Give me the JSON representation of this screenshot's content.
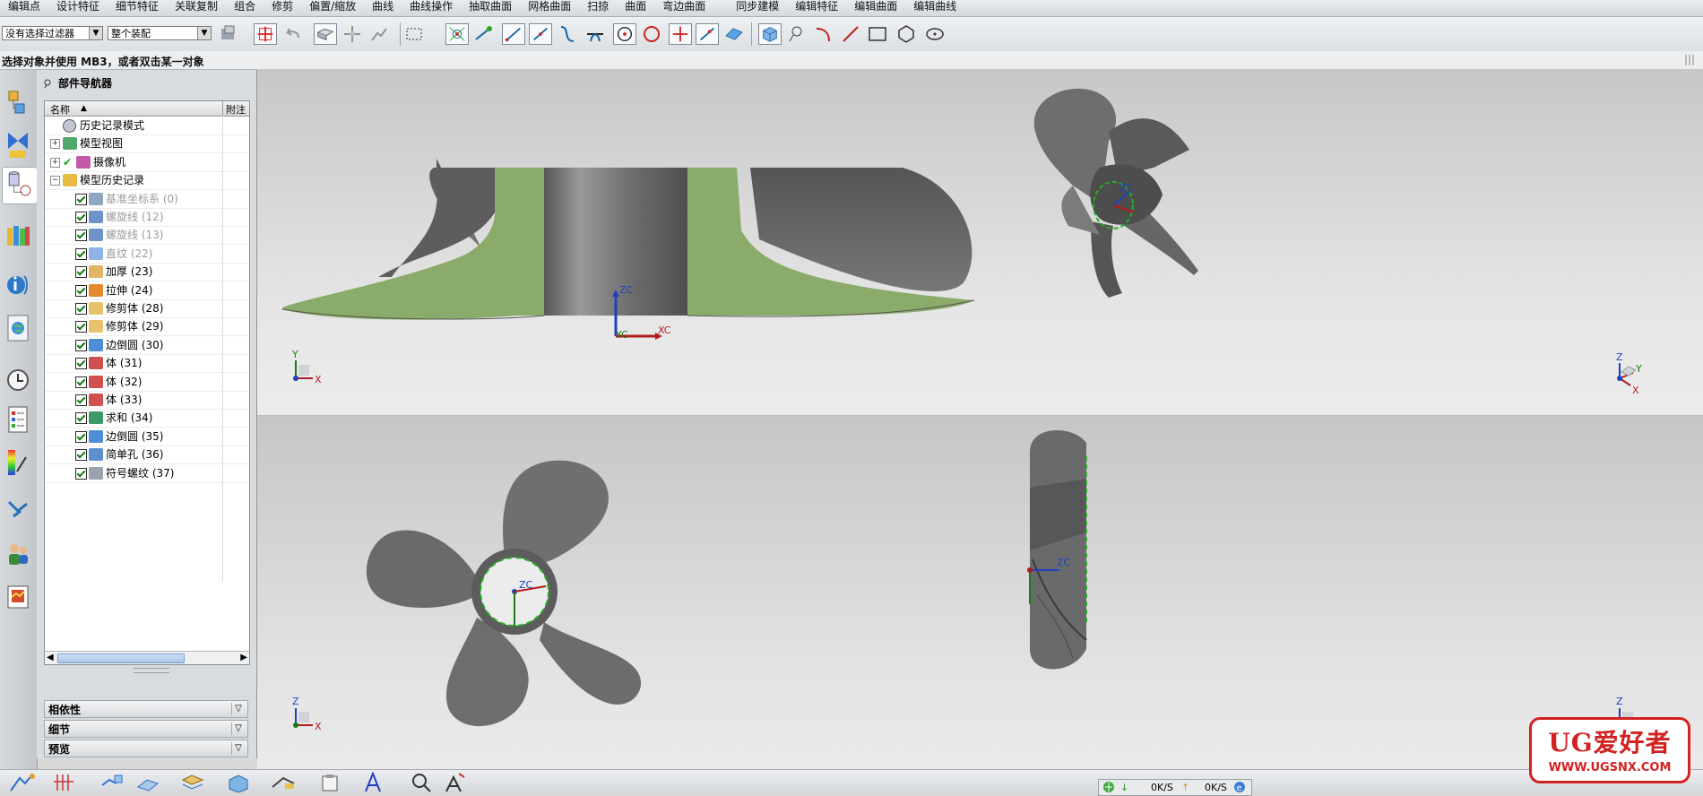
{
  "menubar": {
    "items": [
      "编辑点",
      "设计特征",
      "细节特征",
      "关联复制",
      "组合",
      "修剪",
      "偏置/缩放",
      "曲线",
      "曲线操作",
      "抽取曲面",
      "网格曲面",
      "扫掠",
      "曲面",
      "弯边曲面",
      "同步建模",
      "编辑特征",
      "编辑曲面",
      "编辑曲线"
    ]
  },
  "toolbar": {
    "filter_combo": "没有选择过滤器",
    "scope_combo": "整个装配"
  },
  "prompt": {
    "text": "选择对象并使用 MB3，或者双击某一对象"
  },
  "navigator": {
    "title": "部件导航器",
    "col_name": "名称",
    "col_attach": "附注",
    "nodes": [
      {
        "label": "历史记录模式",
        "kind": "clock",
        "level": 0,
        "expander": "",
        "checked": false,
        "dim": false
      },
      {
        "label": "模型视图",
        "kind": "view",
        "level": 0,
        "expander": "+",
        "checked": false,
        "dim": false
      },
      {
        "label": "摄像机",
        "kind": "camera",
        "level": 0,
        "expander": "+",
        "checked": true,
        "dim": false
      },
      {
        "label": "模型历史记录",
        "kind": "folder",
        "level": 0,
        "expander": "−",
        "checked": false,
        "dim": false
      },
      {
        "label": "基准坐标系 (0)",
        "kind": "csys",
        "level": 1,
        "checked": true,
        "dim": true
      },
      {
        "label": "螺旋线 (12)",
        "kind": "helix",
        "level": 1,
        "checked": true,
        "dim": true
      },
      {
        "label": "螺旋线 (13)",
        "kind": "helix",
        "level": 1,
        "checked": true,
        "dim": true
      },
      {
        "label": "直纹 (22)",
        "kind": "ruled",
        "level": 1,
        "checked": true,
        "dim": true
      },
      {
        "label": "加厚 (23)",
        "kind": "thicken",
        "level": 1,
        "checked": true,
        "dim": false
      },
      {
        "label": "拉伸 (24)",
        "kind": "extrude",
        "level": 1,
        "checked": true,
        "dim": false
      },
      {
        "label": "修剪体 (28)",
        "kind": "trim",
        "level": 1,
        "checked": true,
        "dim": false
      },
      {
        "label": "修剪体 (29)",
        "kind": "trim",
        "level": 1,
        "checked": true,
        "dim": false
      },
      {
        "label": "边倒圆 (30)",
        "kind": "blend",
        "level": 1,
        "checked": true,
        "dim": false
      },
      {
        "label": "体 (31)",
        "kind": "body",
        "level": 1,
        "checked": true,
        "dim": false
      },
      {
        "label": "体 (32)",
        "kind": "body",
        "level": 1,
        "checked": true,
        "dim": false
      },
      {
        "label": "体 (33)",
        "kind": "body",
        "level": 1,
        "checked": true,
        "dim": false
      },
      {
        "label": "求和 (34)",
        "kind": "unite",
        "level": 1,
        "checked": true,
        "dim": false
      },
      {
        "label": "边倒圆 (35)",
        "kind": "blend",
        "level": 1,
        "checked": true,
        "dim": false
      },
      {
        "label": "简单孔 (36)",
        "kind": "hole",
        "level": 1,
        "checked": true,
        "dim": false
      },
      {
        "label": "符号螺纹 (37)",
        "kind": "thread",
        "level": 1,
        "checked": true,
        "dim": false
      }
    ],
    "panels": [
      "相依性",
      "细节",
      "预览"
    ]
  },
  "viewports": {
    "top_left": {
      "view": "front",
      "wcs_z": "ZC",
      "wcs_x": "XC",
      "wcs_y": "YC",
      "triad": [
        "Y",
        "X"
      ]
    },
    "top_right": {
      "view": "isometric",
      "wcs_z": "ZC",
      "triad": [
        "Z",
        "Y",
        "X"
      ]
    },
    "bottom_left": {
      "view": "top",
      "wcs_z": "ZC",
      "triad": [
        "Z",
        "X"
      ]
    },
    "bottom_right": {
      "view": "right",
      "wcs_z": "ZC",
      "wcs_x": "XC",
      "wcs_y": "YC",
      "triad": [
        "Z",
        "Y"
      ]
    }
  },
  "status": {
    "down": "0K/S",
    "up": "0K/S"
  },
  "watermark": {
    "title": "UG爱好者",
    "url": "WWW.UGSNX.COM"
  },
  "colors": {
    "face_green": "#8aab69",
    "body_gray": "#6b6b6b",
    "accent_red": "#d32121"
  }
}
